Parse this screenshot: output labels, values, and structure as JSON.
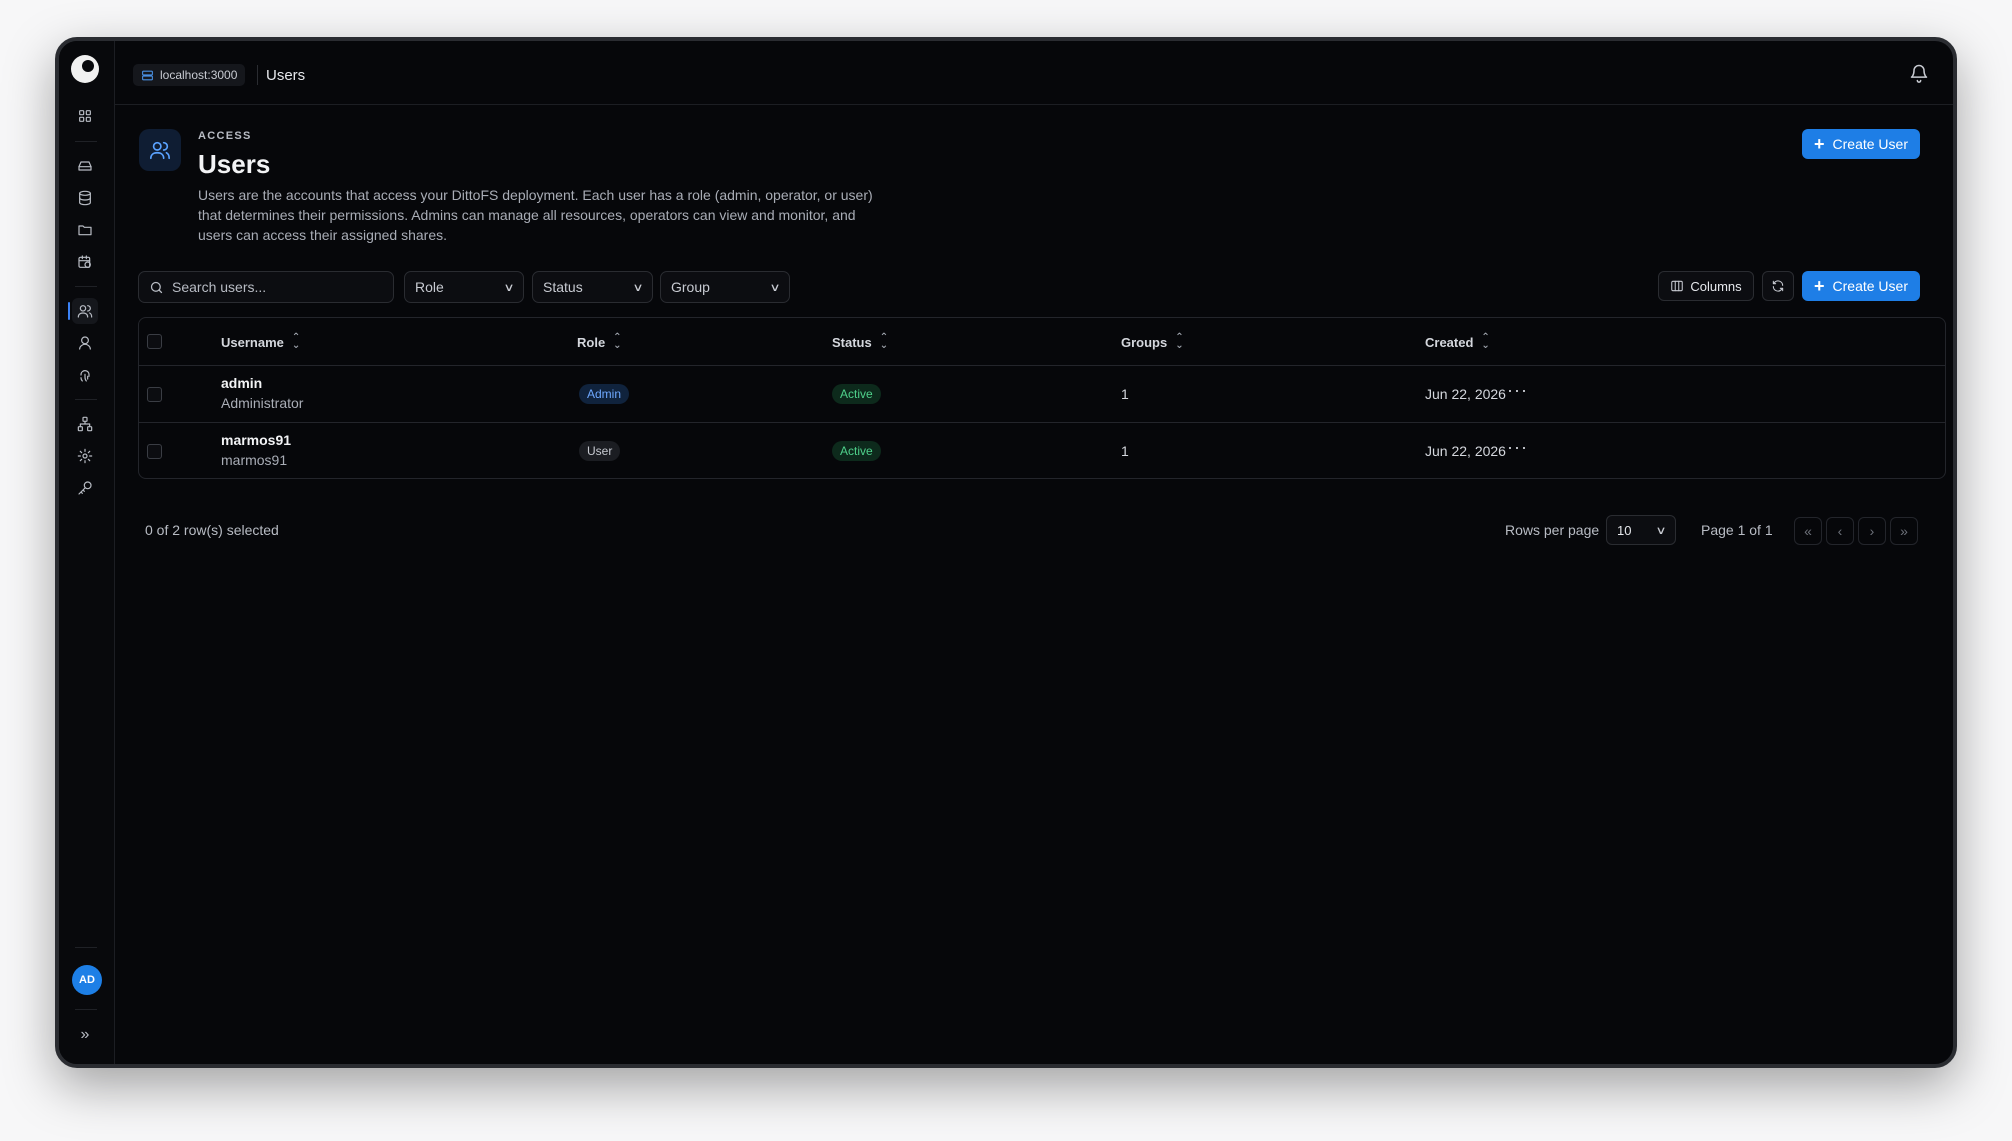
{
  "header": {
    "server": "localhost:3000",
    "breadcrumb": "Users"
  },
  "page": {
    "overline": "ACCESS",
    "title": "Users",
    "description": "Users are the accounts that access your DittoFS deployment. Each user has a role (admin, operator, or user) that determines their permissions. Admins can manage all resources, operators can view and monitor, and users can access their assigned shares.",
    "create_label": "Create User"
  },
  "toolbar": {
    "search_placeholder": "Search users...",
    "role_filter": "Role",
    "status_filter": "Status",
    "group_filter": "Group",
    "columns_label": "Columns",
    "create_label": "Create User"
  },
  "table": {
    "columns": [
      "Username",
      "Role",
      "Status",
      "Groups",
      "Created"
    ],
    "rows": [
      {
        "username": "admin",
        "display_name": "Administrator",
        "role": "Admin",
        "status": "Active",
        "groups": "1",
        "created": "Jun 22, 2026"
      },
      {
        "username": "marmos91",
        "display_name": "marmos91",
        "role": "User",
        "status": "Active",
        "groups": "1",
        "created": "Jun 22, 2026"
      }
    ]
  },
  "footer": {
    "selected": "0 of 2 row(s) selected",
    "rows_per_page_label": "Rows per page",
    "rows_per_page": "10",
    "page_info": "Page 1 of 1"
  },
  "user": {
    "initials": "AD"
  },
  "colors": {
    "accent": "#1e7ee6",
    "active": "#4fd18b",
    "admin_badge": "#6ea8ff"
  }
}
